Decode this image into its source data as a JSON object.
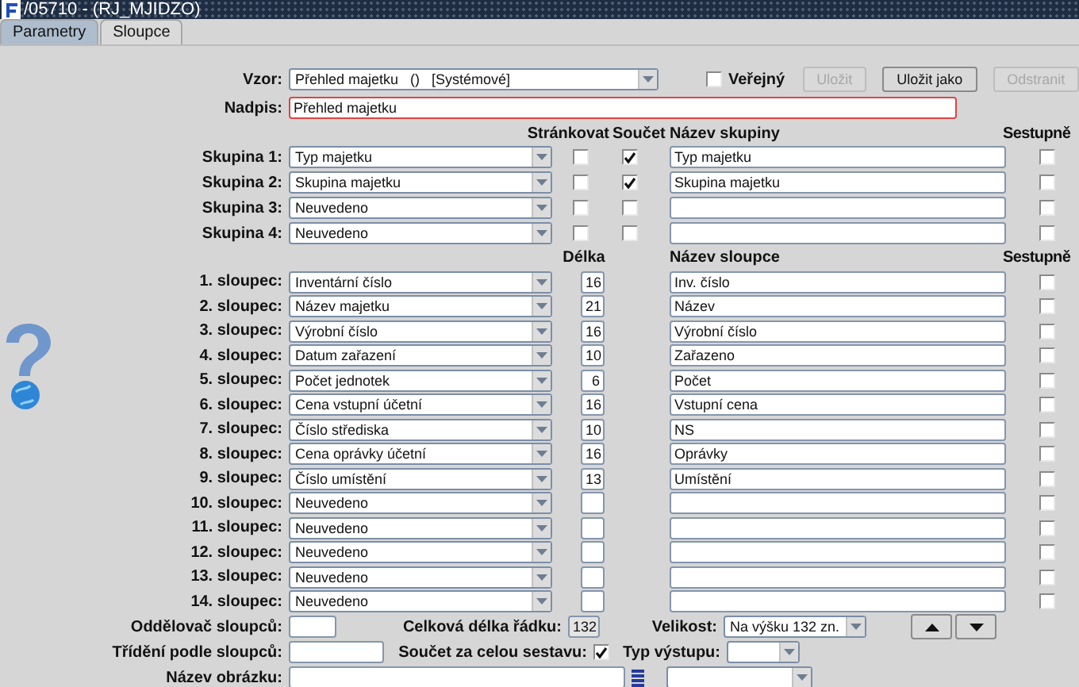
{
  "window": {
    "title": "/05710 - (RJ_MJIDZO)"
  },
  "tabs": [
    {
      "label": "Parametry",
      "selected": false
    },
    {
      "label": "Sloupce",
      "selected": true
    }
  ],
  "template": {
    "label": "Vzor:",
    "value": "Přehled majetku   ()   [Systémové]"
  },
  "public": {
    "label": "Veřejný",
    "checked": false
  },
  "buttons": [
    {
      "label": "Uložit",
      "disabled": true
    },
    {
      "label": "Uložit jako",
      "disabled": false
    },
    {
      "label": "Odstranit",
      "disabled": true
    }
  ],
  "heading": {
    "label": "Nadpis:",
    "value": "Přehled majetku"
  },
  "group_headers": {
    "paging": "Stránkovat",
    "sum": "Součet",
    "name": "Název skupiny",
    "descending": "Sestupně"
  },
  "groups": [
    {
      "label": "Skupina 1:",
      "field": "Typ majetku",
      "paging": false,
      "sum": true,
      "name": "Typ majetku",
      "descending": false
    },
    {
      "label": "Skupina 2:",
      "field": "Skupina majetku",
      "paging": false,
      "sum": true,
      "name": "Skupina majetku",
      "descending": false
    },
    {
      "label": "Skupina 3:",
      "field": "Neuvedeno",
      "paging": false,
      "sum": false,
      "descending": false
    },
    {
      "label": "Skupina 4:",
      "field": "Neuvedeno",
      "paging": false,
      "sum": false,
      "descending": false
    }
  ],
  "column_headers": {
    "length": "Délka",
    "name": "Název sloupce",
    "descending": "Sestupně"
  },
  "columns": [
    {
      "label": "1. sloupec:",
      "field": "Inventární číslo",
      "length": "16",
      "name": "Inv. číslo",
      "descending": false
    },
    {
      "label": "2. sloupec:",
      "field": "Název majetku",
      "length": "21",
      "name": "Název",
      "descending": false
    },
    {
      "label": "3. sloupec:",
      "field": "Výrobní číslo",
      "length": "16",
      "name": "Výrobní číslo",
      "descending": false
    },
    {
      "label": "4. sloupec:",
      "field": "Datum zařazení",
      "length": "10",
      "name": "Zařazeno",
      "descending": false
    },
    {
      "label": "5. sloupec:",
      "field": "Počet jednotek",
      "length": "6",
      "name": "Počet",
      "descending": false
    },
    {
      "label": "6. sloupec:",
      "field": "Cena vstupní účetní",
      "length": "16",
      "name": "Vstupní cena",
      "descending": false
    },
    {
      "label": "7. sloupec:",
      "field": "Číslo střediska",
      "length": "10",
      "name": "NS",
      "descending": false
    },
    {
      "label": "8. sloupec:",
      "field": "Cena oprávky účetní",
      "length": "16",
      "name": "Oprávky",
      "descending": false
    },
    {
      "label": "9. sloupec:",
      "field": "Číslo umístění",
      "length": "13",
      "name": "Umístění",
      "descending": false
    },
    {
      "label": "10. sloupec:",
      "field": "Neuvedeno",
      "descending": false
    },
    {
      "label": "11. sloupec:",
      "field": "Neuvedeno",
      "descending": false
    },
    {
      "label": "12. sloupec:",
      "field": "Neuvedeno",
      "descending": false
    },
    {
      "label": "13. sloupec:",
      "field": "Neuvedeno",
      "descending": false
    },
    {
      "label": "14. sloupec:",
      "field": "Neuvedeno",
      "descending": false
    }
  ],
  "footer": {
    "separator": {
      "label": "Oddělovač sloupců:"
    },
    "total_length": {
      "label": "Celková délka řádku:",
      "value": "132"
    },
    "size": {
      "label": "Velikost:",
      "value": "Na výšku 132 zn."
    },
    "sort": {
      "label": "Třídění podle sloupců:"
    },
    "grand_total": {
      "label": "Součet za celou sestavu:",
      "checked": true
    },
    "output_type": {
      "label": "Typ výstupu:"
    },
    "image": {
      "label": "Název obrázku:"
    }
  }
}
